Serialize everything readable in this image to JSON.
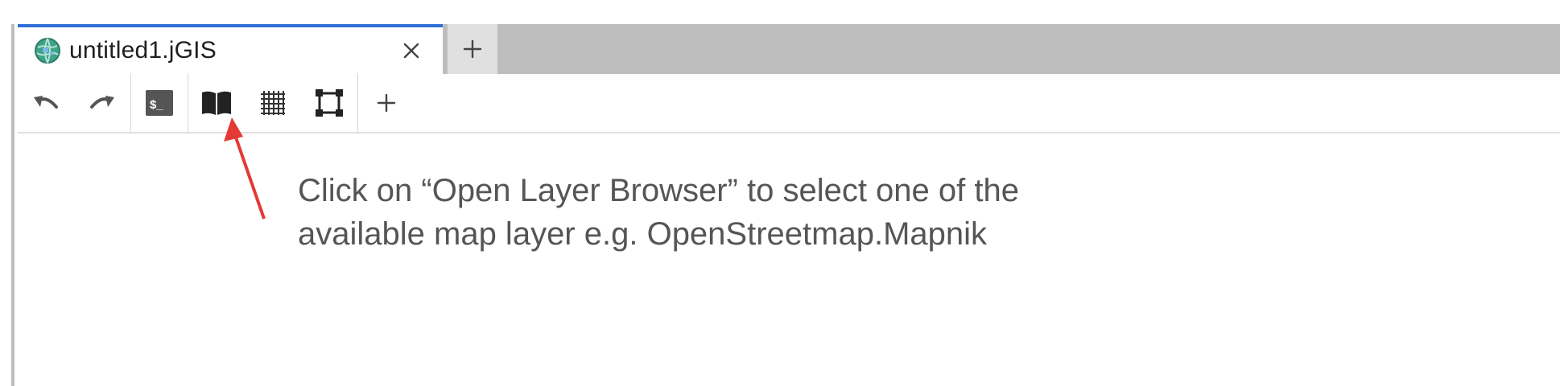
{
  "tab": {
    "title": "untitled1.jGIS",
    "icon": "globe-icon",
    "close_icon": "close-icon"
  },
  "new_tab": {
    "icon": "plus-icon"
  },
  "toolbar": {
    "buttons": [
      {
        "name": "undo-button",
        "icon": "undo-icon"
      },
      {
        "name": "redo-button",
        "icon": "redo-icon"
      },
      {
        "name": "terminal-button",
        "icon": "terminal-icon",
        "label": "$_"
      },
      {
        "name": "open-layer-browser-button",
        "icon": "book-open-icon"
      },
      {
        "name": "grid-button",
        "icon": "grid-icon"
      },
      {
        "name": "bounding-box-button",
        "icon": "bounding-box-icon"
      },
      {
        "name": "add-button",
        "icon": "plus-icon"
      }
    ]
  },
  "annotation": {
    "line1": "Click on “Open Layer Browser” to select one of the",
    "line2": "available map layer e.g. OpenStreetmap.Mapnik"
  },
  "colors": {
    "active_tab_accent": "#2f6fd6",
    "arrow": "#e53935",
    "annotation_text": "#555555"
  }
}
